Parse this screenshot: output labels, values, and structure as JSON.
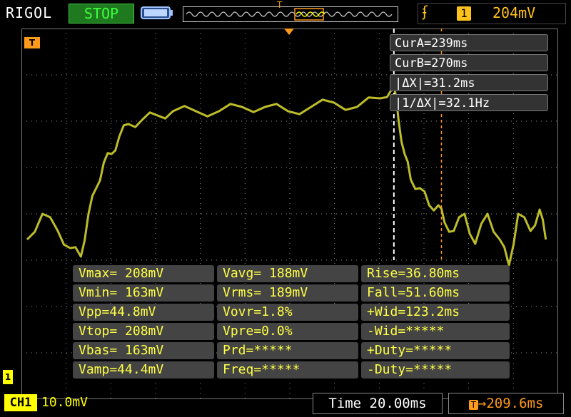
{
  "brand": "RIGOL",
  "run_status": "STOP",
  "trigger": {
    "source": "1",
    "level": "204mV",
    "edge_icon": "rising-edge-icon",
    "color": "#ffc21a"
  },
  "channel_color": "#ffff00",
  "cursors": {
    "a": "CurA=239ms",
    "b": "CurB=270ms",
    "dx": "|ΔX|=31.2ms",
    "inv_dx": "|1/ΔX|=32.1Hz"
  },
  "measurements": {
    "rows": [
      [
        "Vmax= 208mV",
        "Vavg= 188mV",
        "Rise=36.80ms"
      ],
      [
        "Vmin= 163mV",
        "Vrms= 189mV",
        "Fall=51.60ms"
      ],
      [
        "Vpp=44.8mV",
        "Vovr=1.8%",
        "+Wid=123.2ms"
      ],
      [
        "Vtop= 208mV",
        "Vpre=0.0%",
        "-Wid=*****"
      ],
      [
        "Vbas= 163mV",
        "Prd=*****",
        "+Duty=*****"
      ],
      [
        "Vamp=44.4mV",
        "Freq=*****",
        "-Duty=*****"
      ]
    ]
  },
  "bottom": {
    "channel_label": "CH1",
    "channel_scale": "10.0mV",
    "timebase": "Time 20.00ms",
    "trigger_offset": "→209.6ms"
  },
  "markers": {
    "trigger_marker": "T",
    "channel_marker": "1"
  },
  "chart_data": {
    "type": "line",
    "x_unit": "ms",
    "y_unit": "mV",
    "x_range": [
      0,
      280
    ],
    "y_range": [
      130,
      210
    ],
    "cursor_a_ms": 239,
    "cursor_b_ms": 270,
    "series": [
      {
        "x": [
          0,
          10,
          20,
          28,
          35,
          40,
          45,
          50,
          55,
          60,
          66,
          75,
          85,
          95,
          110,
          125,
          140,
          155,
          170,
          185,
          200,
          215,
          230,
          239,
          242,
          246,
          250,
          256,
          262,
          268,
          272,
          278,
          285,
          292,
          300,
          308,
          314,
          320,
          328,
          334,
          338
        ],
        "values": [
          172,
          178,
          174,
          170,
          168,
          178,
          184,
          190,
          192,
          196,
          199,
          200,
          201,
          202,
          202,
          202,
          203,
          203,
          202,
          203,
          204,
          203,
          205,
          208,
          200,
          192,
          186,
          184,
          180,
          180,
          176,
          174,
          178,
          171,
          178,
          172,
          166,
          178,
          174,
          179,
          172
        ]
      }
    ]
  }
}
